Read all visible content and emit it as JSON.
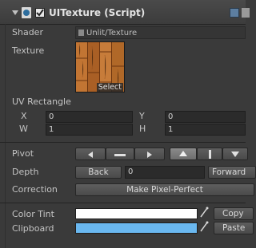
{
  "header": {
    "component_title": "UITexture (Script)",
    "enabled": true,
    "fold_icon": "triangle-down-icon",
    "script_icon": "script-icon"
  },
  "shader": {
    "label": "Shader",
    "value": "Unlit/Texture"
  },
  "texture": {
    "label": "Texture",
    "select_label": "Select"
  },
  "uv_rect": {
    "label": "UV Rectangle",
    "x_label": "X",
    "x_value": "0",
    "y_label": "Y",
    "y_value": "0",
    "w_label": "W",
    "w_value": "1",
    "h_label": "H",
    "h_value": "1"
  },
  "pivot": {
    "label": "Pivot"
  },
  "depth": {
    "label": "Depth",
    "back_label": "Back",
    "value": "0",
    "forward_label": "Forward"
  },
  "correction": {
    "label": "Correction",
    "button_label": "Make Pixel-Perfect"
  },
  "color_tint": {
    "label": "Color Tint",
    "color": "#ffffff",
    "copy_label": "Copy"
  },
  "clipboard": {
    "label": "Clipboard",
    "color": "#6ab8f0",
    "paste_label": "Paste"
  }
}
